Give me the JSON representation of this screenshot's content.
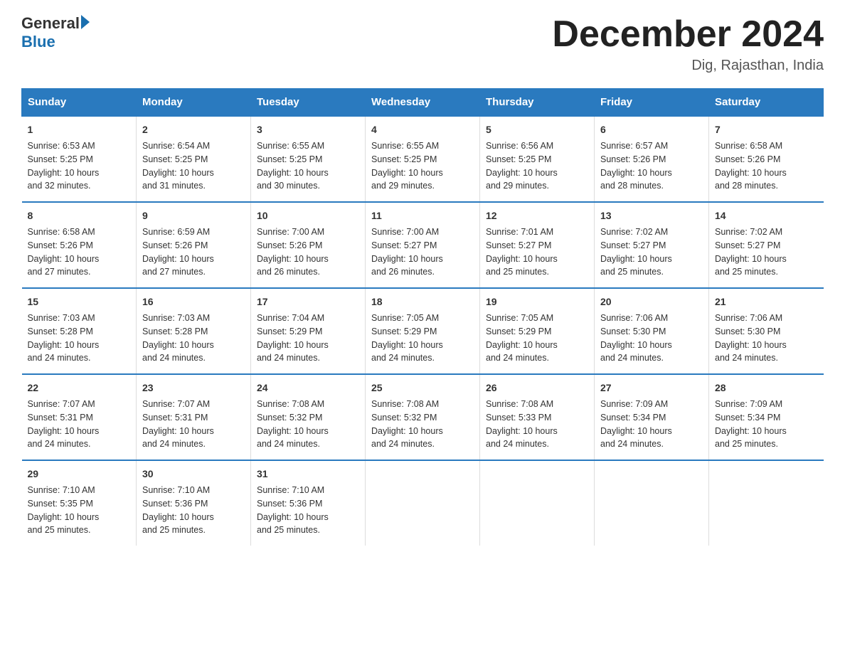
{
  "header": {
    "logo_general": "General",
    "logo_blue": "Blue",
    "month_title": "December 2024",
    "location": "Dig, Rajasthan, India"
  },
  "days_of_week": [
    "Sunday",
    "Monday",
    "Tuesday",
    "Wednesday",
    "Thursday",
    "Friday",
    "Saturday"
  ],
  "weeks": [
    [
      {
        "day": "1",
        "info": "Sunrise: 6:53 AM\nSunset: 5:25 PM\nDaylight: 10 hours\nand 32 minutes."
      },
      {
        "day": "2",
        "info": "Sunrise: 6:54 AM\nSunset: 5:25 PM\nDaylight: 10 hours\nand 31 minutes."
      },
      {
        "day": "3",
        "info": "Sunrise: 6:55 AM\nSunset: 5:25 PM\nDaylight: 10 hours\nand 30 minutes."
      },
      {
        "day": "4",
        "info": "Sunrise: 6:55 AM\nSunset: 5:25 PM\nDaylight: 10 hours\nand 29 minutes."
      },
      {
        "day": "5",
        "info": "Sunrise: 6:56 AM\nSunset: 5:25 PM\nDaylight: 10 hours\nand 29 minutes."
      },
      {
        "day": "6",
        "info": "Sunrise: 6:57 AM\nSunset: 5:26 PM\nDaylight: 10 hours\nand 28 minutes."
      },
      {
        "day": "7",
        "info": "Sunrise: 6:58 AM\nSunset: 5:26 PM\nDaylight: 10 hours\nand 28 minutes."
      }
    ],
    [
      {
        "day": "8",
        "info": "Sunrise: 6:58 AM\nSunset: 5:26 PM\nDaylight: 10 hours\nand 27 minutes."
      },
      {
        "day": "9",
        "info": "Sunrise: 6:59 AM\nSunset: 5:26 PM\nDaylight: 10 hours\nand 27 minutes."
      },
      {
        "day": "10",
        "info": "Sunrise: 7:00 AM\nSunset: 5:26 PM\nDaylight: 10 hours\nand 26 minutes."
      },
      {
        "day": "11",
        "info": "Sunrise: 7:00 AM\nSunset: 5:27 PM\nDaylight: 10 hours\nand 26 minutes."
      },
      {
        "day": "12",
        "info": "Sunrise: 7:01 AM\nSunset: 5:27 PM\nDaylight: 10 hours\nand 25 minutes."
      },
      {
        "day": "13",
        "info": "Sunrise: 7:02 AM\nSunset: 5:27 PM\nDaylight: 10 hours\nand 25 minutes."
      },
      {
        "day": "14",
        "info": "Sunrise: 7:02 AM\nSunset: 5:27 PM\nDaylight: 10 hours\nand 25 minutes."
      }
    ],
    [
      {
        "day": "15",
        "info": "Sunrise: 7:03 AM\nSunset: 5:28 PM\nDaylight: 10 hours\nand 24 minutes."
      },
      {
        "day": "16",
        "info": "Sunrise: 7:03 AM\nSunset: 5:28 PM\nDaylight: 10 hours\nand 24 minutes."
      },
      {
        "day": "17",
        "info": "Sunrise: 7:04 AM\nSunset: 5:29 PM\nDaylight: 10 hours\nand 24 minutes."
      },
      {
        "day": "18",
        "info": "Sunrise: 7:05 AM\nSunset: 5:29 PM\nDaylight: 10 hours\nand 24 minutes."
      },
      {
        "day": "19",
        "info": "Sunrise: 7:05 AM\nSunset: 5:29 PM\nDaylight: 10 hours\nand 24 minutes."
      },
      {
        "day": "20",
        "info": "Sunrise: 7:06 AM\nSunset: 5:30 PM\nDaylight: 10 hours\nand 24 minutes."
      },
      {
        "day": "21",
        "info": "Sunrise: 7:06 AM\nSunset: 5:30 PM\nDaylight: 10 hours\nand 24 minutes."
      }
    ],
    [
      {
        "day": "22",
        "info": "Sunrise: 7:07 AM\nSunset: 5:31 PM\nDaylight: 10 hours\nand 24 minutes."
      },
      {
        "day": "23",
        "info": "Sunrise: 7:07 AM\nSunset: 5:31 PM\nDaylight: 10 hours\nand 24 minutes."
      },
      {
        "day": "24",
        "info": "Sunrise: 7:08 AM\nSunset: 5:32 PM\nDaylight: 10 hours\nand 24 minutes."
      },
      {
        "day": "25",
        "info": "Sunrise: 7:08 AM\nSunset: 5:32 PM\nDaylight: 10 hours\nand 24 minutes."
      },
      {
        "day": "26",
        "info": "Sunrise: 7:08 AM\nSunset: 5:33 PM\nDaylight: 10 hours\nand 24 minutes."
      },
      {
        "day": "27",
        "info": "Sunrise: 7:09 AM\nSunset: 5:34 PM\nDaylight: 10 hours\nand 24 minutes."
      },
      {
        "day": "28",
        "info": "Sunrise: 7:09 AM\nSunset: 5:34 PM\nDaylight: 10 hours\nand 25 minutes."
      }
    ],
    [
      {
        "day": "29",
        "info": "Sunrise: 7:10 AM\nSunset: 5:35 PM\nDaylight: 10 hours\nand 25 minutes."
      },
      {
        "day": "30",
        "info": "Sunrise: 7:10 AM\nSunset: 5:36 PM\nDaylight: 10 hours\nand 25 minutes."
      },
      {
        "day": "31",
        "info": "Sunrise: 7:10 AM\nSunset: 5:36 PM\nDaylight: 10 hours\nand 25 minutes."
      },
      {
        "day": "",
        "info": ""
      },
      {
        "day": "",
        "info": ""
      },
      {
        "day": "",
        "info": ""
      },
      {
        "day": "",
        "info": ""
      }
    ]
  ]
}
